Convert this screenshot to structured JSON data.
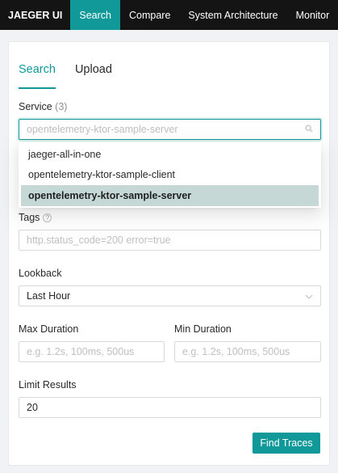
{
  "nav": {
    "brand": "JAEGER UI",
    "items": [
      "Search",
      "Compare",
      "System Architecture",
      "Monitor"
    ]
  },
  "tabs": [
    "Search",
    "Upload"
  ],
  "service": {
    "label": "Service",
    "count": "(3)",
    "value": "opentelemetry-ktor-sample-server",
    "options": [
      "jaeger-all-in-one",
      "opentelemetry-ktor-sample-client",
      "opentelemetry-ktor-sample-server"
    ]
  },
  "tags": {
    "label": "Tags",
    "placeholder": "http.status_code=200 error=true"
  },
  "lookback": {
    "label": "Lookback",
    "value": "Last Hour"
  },
  "max_duration": {
    "label": "Max Duration",
    "placeholder": "e.g. 1.2s, 100ms, 500us"
  },
  "min_duration": {
    "label": "Min Duration",
    "placeholder": "e.g. 1.2s, 100ms, 500us"
  },
  "limit": {
    "label": "Limit Results",
    "value": "20"
  },
  "find_button": "Find Traces",
  "colors": {
    "accent": "#119999",
    "nav_bg": "#141414",
    "selected_option": "#c5d8d6"
  }
}
